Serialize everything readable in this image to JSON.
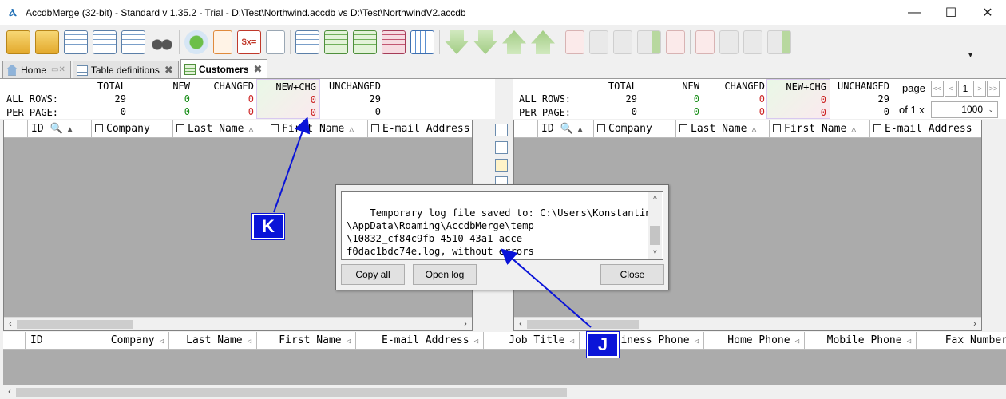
{
  "window": {
    "title": "AccdbMerge (32-bit) - Standard v 1.35.2 - Trial - D:\\Test\\Northwind.accdb vs D:\\Test\\NorthwindV2.accdb",
    "app_icon": "Ⲁ",
    "minimize": "—",
    "maximize": "☐",
    "close": "✕"
  },
  "tabs": [
    {
      "label": "Home",
      "icon": "home-icon"
    },
    {
      "label": "Table definitions",
      "icon": "table-icon"
    },
    {
      "label": "Customers",
      "icon": "grid-icon",
      "active": true
    }
  ],
  "stats": {
    "labels": [
      "ALL ROWS:",
      "PER PAGE:"
    ],
    "headers": [
      "TOTAL",
      "NEW",
      "CHANGED",
      "NEW+CHG",
      "UNCHANGED"
    ],
    "left": {
      "all_rows": [
        "29",
        "0",
        "0",
        "0",
        "29"
      ],
      "per_page": [
        "0",
        "0",
        "0",
        "0",
        "0"
      ]
    },
    "right": {
      "all_rows": [
        "29",
        "0",
        "0",
        "0",
        "29"
      ],
      "per_page": [
        "0",
        "0",
        "0",
        "0",
        "0"
      ]
    }
  },
  "pager": {
    "page_label": "page",
    "first": "<<",
    "prev": "<",
    "current": "1",
    "next": ">",
    "last": ">>",
    "of_label": "of 1 x",
    "page_size": "1000"
  },
  "left_grid": {
    "columns": [
      "ID",
      "Company",
      "Last Name",
      "First Name",
      "E-mail Address"
    ]
  },
  "right_grid": {
    "columns": [
      "ID",
      "Company",
      "Last Name",
      "First Name",
      "E-mail Address"
    ]
  },
  "bottom_grid": {
    "columns": [
      "ID",
      "Company",
      "Last Name",
      "First Name",
      "E-mail Address",
      "Job Title",
      "Business Phone",
      "Home Phone",
      "Mobile Phone",
      "Fax Number"
    ]
  },
  "dialog": {
    "log_text": "Temporary log file saved to: C:\\Users\\Konstantin\n\\AppData\\Roaming\\AccdbMerge\\temp\n\\10832_cf84c9fb-4510-43a1-acce-\nf0dac1bdc74e.log, without errors",
    "copy_all": "Copy all",
    "open_log": "Open log",
    "close": "Close"
  },
  "annotations": {
    "k_label": "K",
    "j_label": "J"
  },
  "colors": {
    "new_green": "#1a8f1a",
    "changed_red": "#cc2222",
    "callout_blue": "#0a14d8",
    "grid_gray": "#ababab"
  }
}
